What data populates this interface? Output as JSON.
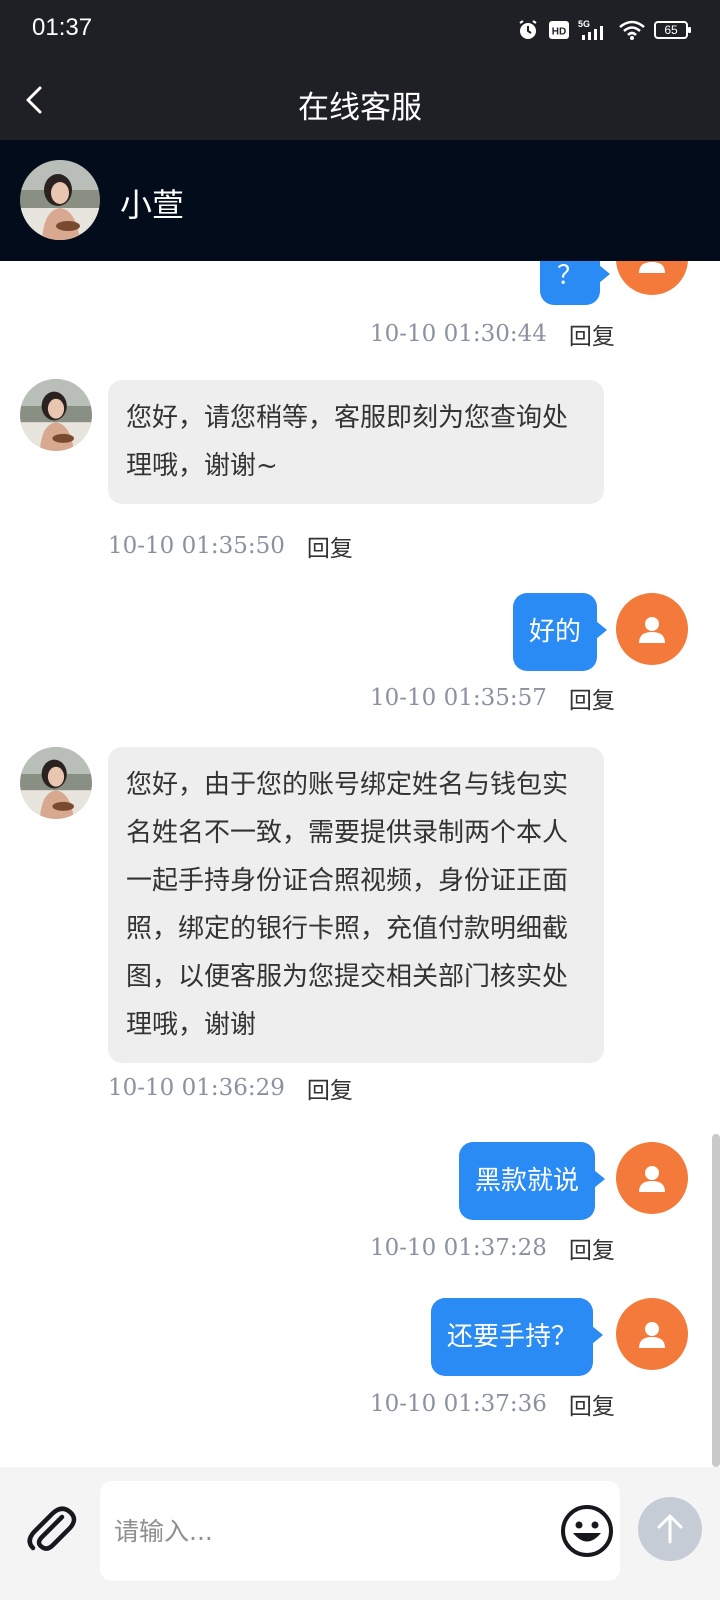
{
  "status_bar": {
    "time": "01:37",
    "battery": "65"
  },
  "header": {
    "title": "在线客服"
  },
  "agent": {
    "name": "小萱"
  },
  "messages": [
    {
      "side": "right",
      "text": "？",
      "time": "10-10 01:30:44",
      "reply": "回复"
    },
    {
      "side": "left",
      "text": "您好，请您稍等，客服即刻为您查询处理哦，谢谢~",
      "time": "10-10 01:35:50",
      "reply": "回复"
    },
    {
      "side": "right",
      "text": "好的",
      "time": "10-10 01:35:57",
      "reply": "回复"
    },
    {
      "side": "left",
      "text": "您好，由于您的账号绑定姓名与钱包实名姓名不一致，需要提供录制两个本人一起手持身份证合照视频，身份证正面照，绑定的银行卡照，充值付款明细截图，以便客服为您提交相关部门核实处理哦，谢谢",
      "time": "10-10 01:36:29",
      "reply": "回复"
    },
    {
      "side": "right",
      "text": "黑款就说",
      "time": "10-10 01:37:28",
      "reply": "回复"
    },
    {
      "side": "right",
      "text": "还要手持？",
      "time": "10-10 01:37:36",
      "reply": "回复"
    }
  ],
  "input": {
    "placeholder": "请输入..."
  },
  "colors": {
    "header_bg": "#1f2025",
    "agent_bar_bg": "#030c1b",
    "user_bubble": "#2a8bf5",
    "agent_bubble": "#eeeeee",
    "user_avatar": "#f47a3c"
  }
}
